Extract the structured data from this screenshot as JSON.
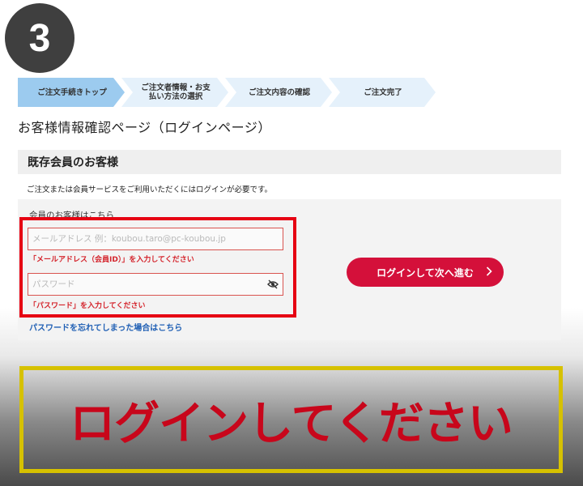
{
  "step_badge": "3",
  "steps": [
    {
      "label": "ご注文手続きトップ"
    },
    {
      "label": "ご注文者情報・お支払い方法の選択"
    },
    {
      "label": "ご注文内容の確認"
    },
    {
      "label": "ご注文完了"
    }
  ],
  "page_title": "お客様情報確認ページ（ログインページ）",
  "panel": {
    "heading": "既存会員のお客様",
    "intro": "ご注文または会員サービスをご利用いただくにはログインが必要です。",
    "member_label": "会員のお客様はこちら"
  },
  "form": {
    "email_placeholder": "メールアドレス 例：koubou.taro@pc-koubou.jp",
    "email_error": "「メールアドレス（会員ID）」を入力してください",
    "password_placeholder": "パスワード",
    "password_error": "「パスワード」を入力してください",
    "forgot_link": "パスワードを忘れてしまった場合はこちら",
    "login_button": "ログインして次へ進む"
  },
  "banner_text": "ログインしてください",
  "colors": {
    "accent_red": "#d4103a",
    "error_red": "#d4232b",
    "highlight_frame": "#e60012",
    "banner_frame": "#d6c100",
    "active_step": "#9ccbef",
    "inactive_step": "#e5f1fb"
  },
  "icons": {
    "password_toggle": "eye-slash-icon",
    "button_arrow": "chevron-right-icon"
  }
}
